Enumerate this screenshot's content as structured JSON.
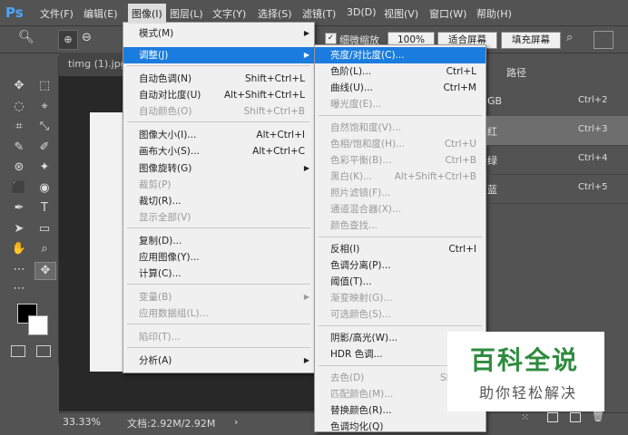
{
  "app": {
    "logo": "Ps"
  },
  "menubar": {
    "items": [
      "文件(F)",
      "编辑(E)",
      "图像(I)",
      "图层(L)",
      "文字(Y)",
      "选择(S)",
      "滤镜(T)",
      "3D(D)",
      "视图(V)",
      "窗口(W)",
      "帮助(H)"
    ],
    "active_index": 2
  },
  "options": {
    "fine_zoom_label": "细微缩放",
    "zoom_100": "100%",
    "fit_screen": "适合屏幕",
    "fill_screen": "填充屏幕"
  },
  "document": {
    "tab": "timg (1).jpg"
  },
  "status": {
    "zoom": "33.33%",
    "doc_info": "文档:2.92M/2.92M",
    "arrow": "›"
  },
  "right_panel": {
    "tab": "路径",
    "rows": [
      {
        "label": "GB",
        "shortcut": "Ctrl+2"
      },
      {
        "label": "红",
        "shortcut": "Ctrl+3"
      },
      {
        "label": "绿",
        "shortcut": "Ctrl+4"
      },
      {
        "label": "蓝",
        "shortcut": "Ctrl+5"
      }
    ]
  },
  "image_menu": {
    "items": [
      {
        "label": "模式(M)",
        "shortcut": "",
        "submenu": true,
        "disabled": false
      },
      {
        "label": "调整(J)",
        "shortcut": "",
        "submenu": true,
        "disabled": false,
        "highlight": true
      },
      {
        "label": "自动色调(N)",
        "shortcut": "Shift+Ctrl+L",
        "disabled": false
      },
      {
        "label": "自动对比度(U)",
        "shortcut": "Alt+Shift+Ctrl+L",
        "disabled": false
      },
      {
        "label": "自动颜色(O)",
        "shortcut": "Shift+Ctrl+B",
        "disabled": true
      },
      {
        "label": "图像大小(I)...",
        "shortcut": "Alt+Ctrl+I",
        "disabled": false
      },
      {
        "label": "画布大小(S)...",
        "shortcut": "Alt+Ctrl+C",
        "disabled": false
      },
      {
        "label": "图像旋转(G)",
        "shortcut": "",
        "submenu": true,
        "disabled": false
      },
      {
        "label": "裁剪(P)",
        "shortcut": "",
        "disabled": true
      },
      {
        "label": "裁切(R)...",
        "shortcut": "",
        "disabled": false
      },
      {
        "label": "显示全部(V)",
        "shortcut": "",
        "disabled": true
      },
      {
        "label": "复制(D)...",
        "shortcut": "",
        "disabled": false
      },
      {
        "label": "应用图像(Y)...",
        "shortcut": "",
        "disabled": false
      },
      {
        "label": "计算(C)...",
        "shortcut": "",
        "disabled": false
      },
      {
        "label": "变量(B)",
        "shortcut": "",
        "submenu": true,
        "disabled": true
      },
      {
        "label": "应用数据组(L)...",
        "shortcut": "",
        "disabled": true
      },
      {
        "label": "陷印(T)...",
        "shortcut": "",
        "disabled": true
      },
      {
        "label": "分析(A)",
        "shortcut": "",
        "submenu": true,
        "disabled": false
      }
    ]
  },
  "adjust_menu": {
    "items": [
      {
        "label": "亮度/对比度(C)...",
        "shortcut": "",
        "disabled": false,
        "highlight": true
      },
      {
        "label": "色阶(L)...",
        "shortcut": "Ctrl+L",
        "disabled": false
      },
      {
        "label": "曲线(U)...",
        "shortcut": "Ctrl+M",
        "disabled": false
      },
      {
        "label": "曝光度(E)...",
        "shortcut": "",
        "disabled": true
      },
      {
        "label": "自然饱和度(V)...",
        "shortcut": "",
        "disabled": true
      },
      {
        "label": "色相/饱和度(H)...",
        "shortcut": "Ctrl+U",
        "disabled": true
      },
      {
        "label": "色彩平衡(B)...",
        "shortcut": "Ctrl+B",
        "disabled": true
      },
      {
        "label": "黑白(K)...",
        "shortcut": "Alt+Shift+Ctrl+B",
        "disabled": true
      },
      {
        "label": "照片滤镜(F)...",
        "shortcut": "",
        "disabled": true
      },
      {
        "label": "通道混合器(X)...",
        "shortcut": "",
        "disabled": true
      },
      {
        "label": "颜色查找...",
        "shortcut": "",
        "disabled": true
      },
      {
        "label": "反相(I)",
        "shortcut": "Ctrl+I",
        "disabled": false
      },
      {
        "label": "色调分离(P)...",
        "shortcut": "",
        "disabled": false
      },
      {
        "label": "阈值(T)...",
        "shortcut": "",
        "disabled": false
      },
      {
        "label": "渐变映射(G)...",
        "shortcut": "",
        "disabled": true
      },
      {
        "label": "可选颜色(S)...",
        "shortcut": "",
        "disabled": true
      },
      {
        "label": "阴影/高光(W)...",
        "shortcut": "",
        "disabled": false
      },
      {
        "label": "HDR 色调...",
        "shortcut": "",
        "disabled": false
      },
      {
        "label": "去色(D)",
        "shortcut": "Shift+C",
        "disabled": true
      },
      {
        "label": "匹配颜色(M)...",
        "shortcut": "",
        "disabled": true
      },
      {
        "label": "替换颜色(R)...",
        "shortcut": "",
        "disabled": false
      },
      {
        "label": "色调均化(Q)",
        "shortcut": "",
        "disabled": false
      }
    ]
  },
  "watermark": {
    "title": "百科全说",
    "subtitle": "助你轻松解决"
  }
}
